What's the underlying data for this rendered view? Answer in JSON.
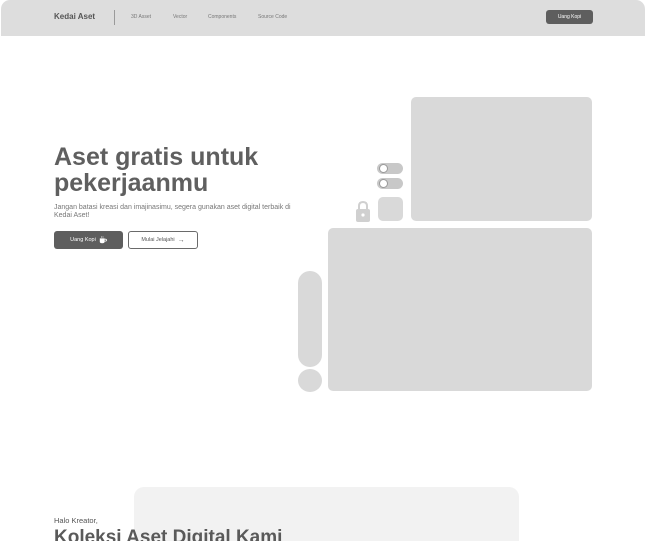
{
  "navbar": {
    "brand": "Kedai Aset",
    "links": [
      "3D Asset",
      "Vector",
      "Components",
      "Source Code"
    ],
    "cta_label": "Uang Kopi"
  },
  "hero": {
    "title": "Aset gratis untuk pekerjaanmu",
    "subtitle": "Jangan batasi kreasi dan imajinasimu, segera gunakan aset digital terbaik di Kedai Aset!",
    "primary_button": "Uang Kopi",
    "secondary_button": "Mulai Jelajahi"
  },
  "collection": {
    "eyebrow": "Halo Kreator,",
    "title": "Koleksi Aset Digital Kami"
  },
  "colors": {
    "primary": "#5e5e5e",
    "placeholder": "#d9d9d9",
    "navbar_bg": "#dddddd"
  },
  "icons": {
    "primary_button_icon": "coffee-cup-icon",
    "secondary_button_icon": "arrow-right-icon",
    "hero_decor": "lock-icon"
  }
}
